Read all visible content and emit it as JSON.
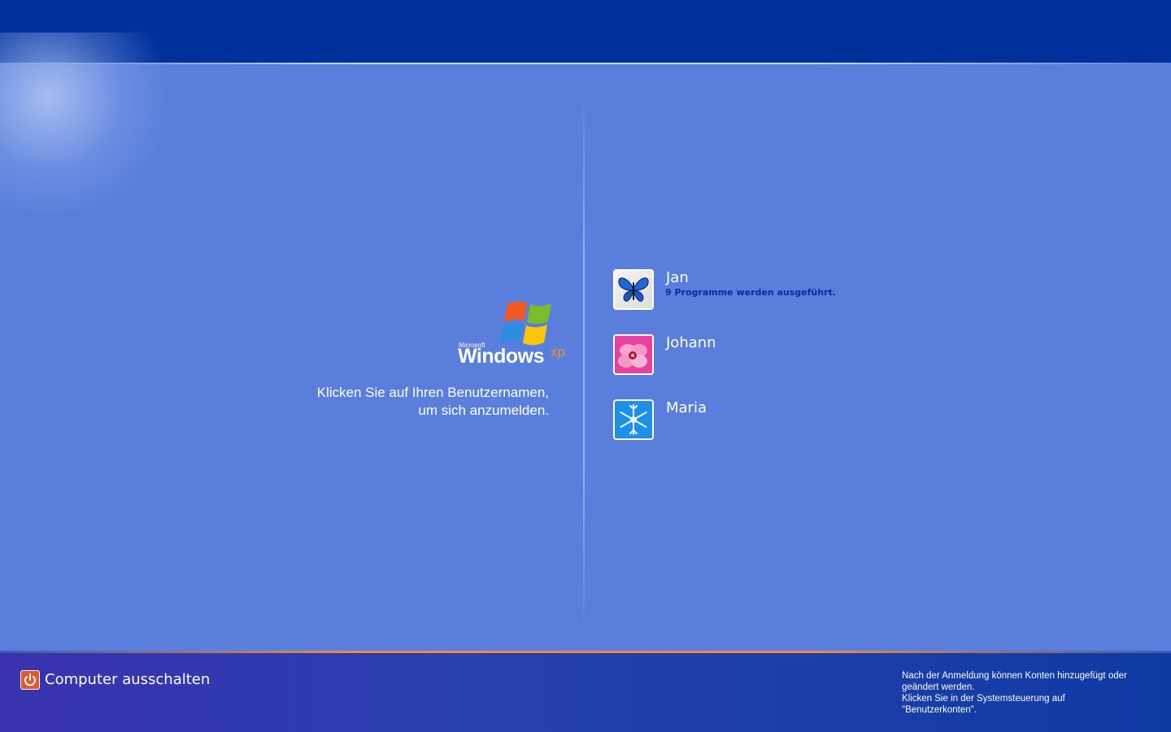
{
  "logo": {
    "microsoft": "Microsoft",
    "windows": "Windows",
    "xp": "xp"
  },
  "instructions": {
    "line1": "Klicken Sie auf Ihren Benutzernamen,",
    "line2": "um sich anzumelden."
  },
  "users": [
    {
      "name": "Jan",
      "status": "9 Programme werden ausgeführt.",
      "picture": "butterfly-icon"
    },
    {
      "name": "Johann",
      "status": "",
      "picture": "flower-icon"
    },
    {
      "name": "Maria",
      "status": "",
      "picture": "snowflake-icon"
    }
  ],
  "footer": {
    "shutdown_label": "Computer ausschalten",
    "shutdown_icon": "power-icon",
    "hint_lines": [
      "Nach der Anmeldung können Konten hinzugefügt oder",
      "geändert werden.",
      "Klicken Sie in der Systemsteuerung auf",
      "\"Benutzerkonten\"."
    ]
  },
  "colors": {
    "background": "#5a7edc",
    "top_bar": "#00309c",
    "status_text": "#00309c",
    "accent_orange": "#f08a3c"
  }
}
